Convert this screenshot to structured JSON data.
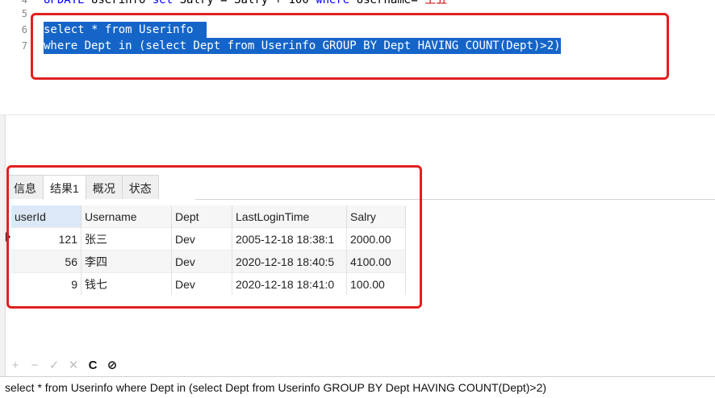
{
  "editor": {
    "lines": [
      {
        "n": "4",
        "parts": [
          [
            "kw",
            "UPDATE"
          ],
          [
            "",
            " Userinfo "
          ],
          [
            "kw",
            "set"
          ],
          [
            "",
            " Salry = Salry + 100 "
          ],
          [
            "kw",
            "where"
          ],
          [
            "",
            " Username="
          ],
          [
            "str",
            "'王五'"
          ]
        ]
      },
      {
        "n": "5",
        "parts": []
      },
      {
        "n": "6",
        "parts": [
          [
            "",
            "select * from Userinfo  "
          ]
        ]
      },
      {
        "n": "7",
        "parts": [
          [
            "",
            "where Dept in (select Dept from Userinfo GROUP BY Dept HAVING COUNT(Dept)>2)"
          ]
        ]
      }
    ]
  },
  "result": {
    "tabs": [
      "信息",
      "结果1",
      "概况",
      "状态"
    ],
    "active_tab": 1,
    "columns": [
      "userId",
      "Username",
      "Dept",
      "LastLoginTime",
      "Salry"
    ],
    "rows": [
      [
        "121",
        "张三",
        "Dev",
        "2005-12-18 18:38:1",
        "2000.00"
      ],
      [
        "56",
        "李四",
        "Dev",
        "2020-12-18 18:40:5",
        "4100.00"
      ],
      [
        "9",
        "钱七",
        "Dev",
        "2020-12-18 18:41:0",
        "100.00"
      ]
    ]
  },
  "toolbar": {
    "icons": [
      "plus-icon",
      "minus-icon",
      "check-icon",
      "cross-icon",
      "refresh-icon",
      "stop-icon"
    ],
    "glyphs": [
      "+",
      "−",
      "✓",
      "✕",
      "C",
      "⊘"
    ]
  },
  "status": {
    "text": "select * from Userinfo  where Dept in (select Dept from Userinfo GROUP BY Dept HAVING COUNT(Dept)>2)"
  },
  "colors": {
    "selection": "#1565c9",
    "highlight_box": "#e02020"
  }
}
